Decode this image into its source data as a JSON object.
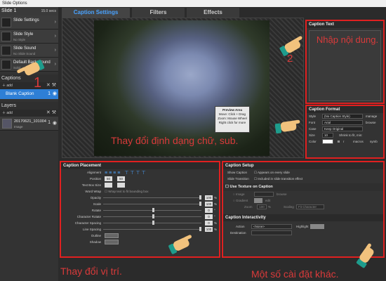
{
  "window_title": "Slide Options",
  "left": {
    "slide_title": "Slide 1",
    "duration": "15.0 secs",
    "settings": [
      {
        "label": "Slide Settings",
        "sub": ""
      },
      {
        "label": "Slide Style",
        "sub": "No Style"
      },
      {
        "label": "Slide Sound",
        "sub": "No Slide Sound"
      },
      {
        "label": "Default Background",
        "sub": "Solid"
      }
    ],
    "captions_header": "Captions",
    "captions_add": "add",
    "caption_item": {
      "label": "Blank Caption",
      "num": "1"
    },
    "layers_header": "Layers",
    "layers_add": "add",
    "layer_item": {
      "label": "20170621_101004",
      "sub": "Image",
      "num": "1"
    }
  },
  "tabs": [
    {
      "label": "Caption Settings",
      "active": true
    },
    {
      "label": "Filters",
      "active": false
    },
    {
      "label": "Effects",
      "active": false
    }
  ],
  "preview": {
    "area_title": "Preview Area",
    "area_lines": [
      "Move: Click + Drag",
      "Zoom: Mouse Wheel",
      "Right click for more"
    ]
  },
  "caption_text": {
    "header": "Caption Text",
    "note": "Nhập nội dung."
  },
  "caption_format": {
    "header": "Caption Format",
    "style_label": "Style",
    "style_value": "(No Caption Style)",
    "style_btn": "manage",
    "font_label": "Font",
    "font_value": "Arial",
    "font_btn": "browse",
    "case_label": "Case",
    "case_value": "Keep Original",
    "size_label": "Size",
    "size_value": "10",
    "shrink_label": "Shrink to fit, min:",
    "color_label": "Color",
    "macro_label": "macros",
    "symbols_label": "symb"
  },
  "caption_placement": {
    "header": "Caption Placement",
    "alignment": "Alignment",
    "position_label": "Position",
    "pos_x": "50",
    "pos_y": "50",
    "textbox_label": "Text Box Size",
    "box_w": "",
    "box_h": "",
    "wordwrap_label": "Word Wrap",
    "wordwrap_option": "Wrap text to fit bounding box",
    "rows": [
      {
        "label": "Opacity",
        "value": "100",
        "unit": "%"
      },
      {
        "label": "Scale",
        "value": "100",
        "unit": "%"
      },
      {
        "label": "Rotate",
        "value": "0",
        "unit": "°"
      },
      {
        "label": "Character Rotate",
        "value": "0",
        "unit": "°"
      },
      {
        "label": "Character Spacing",
        "value": "0",
        "unit": "%"
      },
      {
        "label": "Line Spacing",
        "value": "100",
        "unit": "%"
      }
    ],
    "outline_label": "Outline",
    "shadow_label": "Shadow"
  },
  "caption_setup": {
    "header": "Caption Setup",
    "show_caption": "Show Caption",
    "appears_every": "Appears on every slide",
    "slide_transition": "Slide Transition",
    "included_transition": "Included in slide transition effect",
    "use_texture": "Use Texture on Caption",
    "image_label": "Image",
    "browse": "browse",
    "gradient_label": "Gradient",
    "add": "edit",
    "zoom_label": "Zoom",
    "zoom_value": "100",
    "zoom_unit": "%",
    "scaling_label": "Scaling",
    "scaling_value": "Fit Character"
  },
  "caption_interactivity": {
    "header": "Caption Interactivity",
    "action_label": "Action",
    "action_value": "<None>",
    "highlight_label": "Highlight",
    "destination_label": "Destination"
  },
  "annotations": {
    "step1": "1",
    "step2": "2",
    "preview_note": "Thay đổi định dạng chữ, sub.",
    "placement_note": "Thay đổi vị trí.",
    "other_note": "Một số cài đặt khác."
  },
  "colors": {
    "accent": "#2e7fd6",
    "highlight_border": "#e02020",
    "annotation_text": "#d93a3a",
    "cuff": "#1e9c8c"
  }
}
